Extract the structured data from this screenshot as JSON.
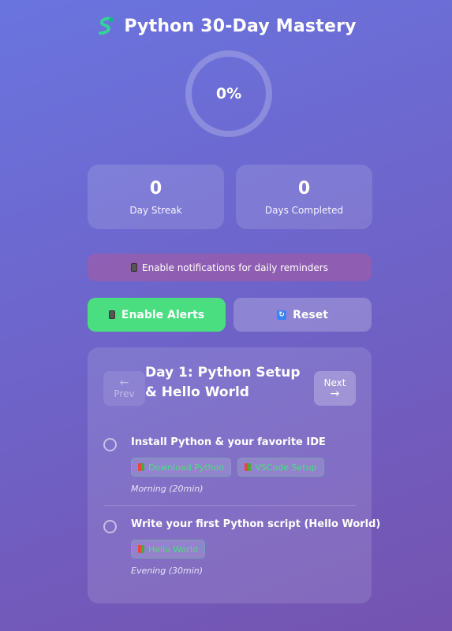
{
  "header": {
    "title": "Python 30-Day Mastery",
    "icon": "snake-icon"
  },
  "progress": {
    "percent_text": "0%",
    "percent": 0
  },
  "stats": [
    {
      "value": "0",
      "label": "Day Streak"
    },
    {
      "value": "0",
      "label": "Days Completed"
    }
  ],
  "notice": {
    "text": "Enable notifications for daily reminders",
    "icon": "phone-icon"
  },
  "buttons": {
    "alerts_label": "Enable Alerts",
    "reset_label": "Reset",
    "alerts_color": "#4ade80"
  },
  "day_card": {
    "prev_arrow": "←",
    "prev_label": "Prev",
    "next_label": "Next",
    "next_arrow": "→",
    "title": "Day 1: Python Setup & Hello World",
    "tasks": [
      {
        "text": "Install Python & your favorite IDE",
        "resources": [
          "Download Python",
          "VSCode Setup"
        ],
        "time": "Morning (20min)",
        "completed": false
      },
      {
        "text": "Write your first Python script (Hello World)",
        "resources": [
          "Hello World"
        ],
        "time": "Evening (30min)",
        "completed": false
      }
    ]
  }
}
